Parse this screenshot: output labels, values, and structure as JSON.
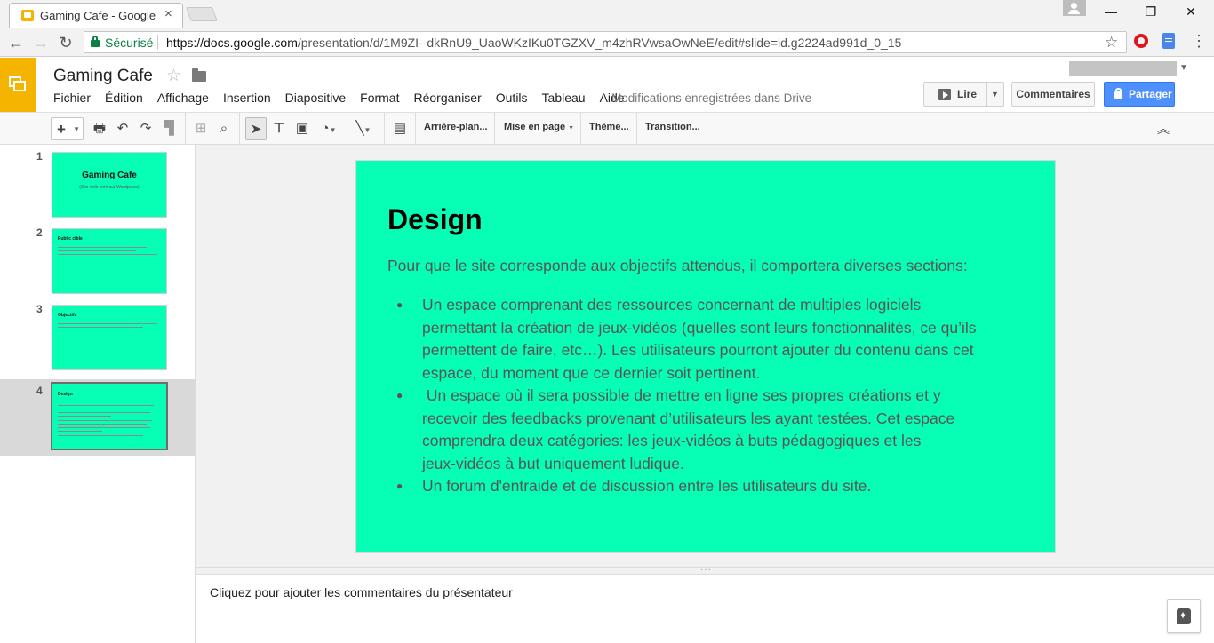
{
  "browser": {
    "tab_title": "Gaming Cafe - Google Slides",
    "tab_close": "×",
    "secure_label": "Sécurisé",
    "url_host": "https://docs.google.com",
    "url_path": "/presentation/d/1M9ZI--dkRnU9_UaoWKzIKu0TGZXV_m4zhRVwsaOwNeE/edit#slide=id.g2224ad991d_0_15",
    "nav_back": "←",
    "nav_forward": "→",
    "nav_reload": "↻",
    "star": "☆",
    "menu": "⋮",
    "win_minimize": "—",
    "win_maximize": "❐",
    "win_close": "✕"
  },
  "app": {
    "doc_title": "Gaming Cafe",
    "title_star": "☆",
    "menus": [
      "Fichier",
      "Édition",
      "Affichage",
      "Insertion",
      "Diapositive",
      "Format",
      "Réorganiser",
      "Outils",
      "Tableau",
      "Aide"
    ],
    "save_status": "Modifications enregistrées dans Drive",
    "present_label": "Lire",
    "comments_label": "Commentaires",
    "share_label": "Partager",
    "brand_color": "#f4b400",
    "share_color": "#4d90fe"
  },
  "toolbar": {
    "new_slide": "+",
    "background": "Arrière-plan...",
    "layout": "Mise en page",
    "theme": "Thème...",
    "transition": "Transition...",
    "icons": [
      "print-icon",
      "undo-icon",
      "redo-icon",
      "paint-format-icon",
      "zoom-fit-icon",
      "zoom-icon",
      "select-icon",
      "text-box-icon",
      "image-icon",
      "shape-icon",
      "line-icon",
      "comment-icon",
      "collapse-icon"
    ]
  },
  "filmstrip": {
    "slides": [
      {
        "num": "1",
        "title": "Gaming Cafe",
        "subtitle": "(Site web créé sur Wordpress)"
      },
      {
        "num": "2",
        "title": "Public cible"
      },
      {
        "num": "3",
        "title": "Objectifs"
      },
      {
        "num": "4",
        "title": "Design"
      }
    ],
    "selected_index": 4
  },
  "slide": {
    "background_color": "#06ffb5",
    "title": "Design",
    "intro": "Pour que le site corresponde aux objectifs attendus, il comportera diverses sections:",
    "bullets": [
      [
        "Un espace comprenant des ressources concernant de multiples logiciels",
        "permettant la création de jeux-vidéos (quelles sont leurs fonctionnalités, ce qu’ils",
        "permettent de faire, etc…). Les utilisateurs pourront ajouter du contenu dans cet",
        "espace, du moment que ce dernier soit pertinent."
      ],
      [
        " Un espace où il sera possible de mettre en ligne ses propres créations et y",
        "recevoir des feedbacks provenant d’utilisateurs les ayant testées. Cet espace",
        "comprendra deux catégories: les jeux-vidéos à buts pédagogiques et les",
        "jeux-vidéos à but uniquement ludique."
      ],
      [
        "Un forum d'entraide et de discussion entre les utilisateurs du site."
      ]
    ]
  },
  "notes": {
    "placeholder": "Cliquez pour ajouter les commentaires du présentateur"
  }
}
